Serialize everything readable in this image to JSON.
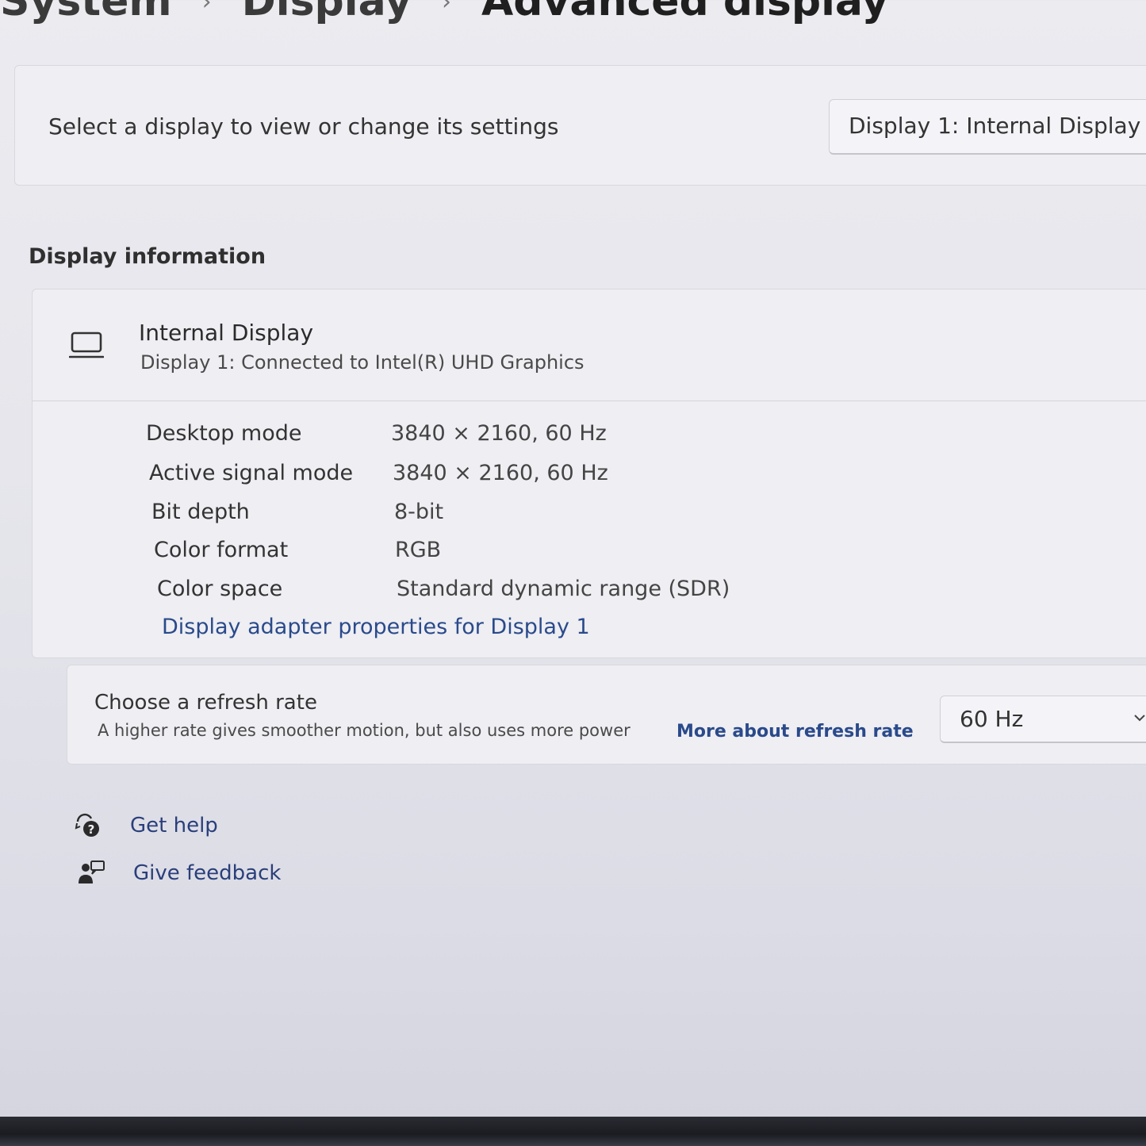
{
  "breadcrumb": {
    "items": [
      "System",
      "Display",
      "Advanced display"
    ],
    "separator": "›"
  },
  "select_display": {
    "label": "Select a display to view or change its settings",
    "selected": "Display 1: Internal Display"
  },
  "display_information": {
    "section_title": "Display information",
    "device_icon": "laptop-icon",
    "device_name": "Internal Display",
    "device_subtitle": "Display 1: Connected to Intel(R) UHD Graphics",
    "rows": [
      {
        "key": "Desktop mode",
        "value": "3840 × 2160, 60 Hz"
      },
      {
        "key": "Active signal mode",
        "value": "3840 × 2160, 60 Hz"
      },
      {
        "key": "Bit depth",
        "value": "8-bit"
      },
      {
        "key": "Color format",
        "value": "RGB"
      },
      {
        "key": "Color space",
        "value": "Standard dynamic range (SDR)"
      }
    ],
    "adapter_link": "Display adapter properties for Display 1"
  },
  "refresh_rate": {
    "title": "Choose a refresh rate",
    "description": "A higher rate gives smoother motion, but also uses more power",
    "link": "More about refresh rate",
    "selected": "60 Hz"
  },
  "footer_links": {
    "get_help": "Get help",
    "give_feedback": "Give feedback"
  },
  "colors": {
    "link": "#2a4a8a",
    "card_background": "#eeeef3",
    "page_background": "#e6e6ec"
  }
}
